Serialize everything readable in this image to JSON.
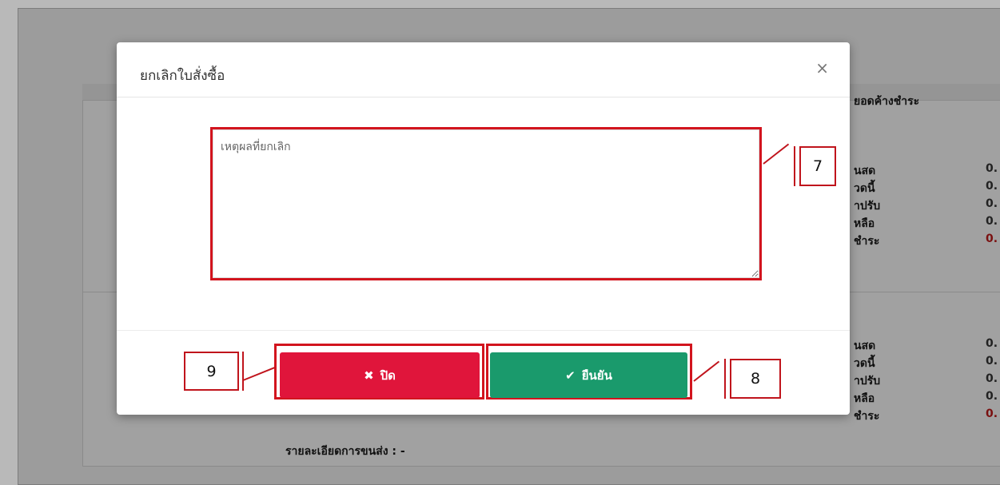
{
  "modal": {
    "title": "ยกเลิกใบสั่งซื้อ",
    "close_symbol": "×",
    "reason_placeholder": "เหตุผลที่ยกเลิก",
    "buttons": {
      "close_label": "ปิด",
      "confirm_label": "ยืนยัน"
    }
  },
  "icons": {
    "close_icon": "×",
    "times_icon": "✖",
    "check_icon": "✔"
  },
  "callouts": {
    "textarea": "7",
    "confirm": "8",
    "close": "9"
  },
  "background": {
    "column_header": "ยอดค้างชำระ",
    "group1": [
      "นสด",
      "วดนี้",
      "าปรับ",
      "หลือ",
      "ชำระ"
    ],
    "group1_values": [
      "0.",
      "0.",
      "0.",
      "0.",
      "0."
    ],
    "group2": [
      "นสด",
      "วดนี้",
      "าปรับ",
      "หลือ",
      "ชำระ"
    ],
    "group2_values": [
      "0.",
      "0.",
      "0.",
      "0.",
      "0."
    ],
    "shipping_detail": "รายละเอียดการขนส่ง : -"
  },
  "colors": {
    "danger": "#e0153b",
    "success": "#1a9a6c",
    "annotation": "#d2141e"
  }
}
